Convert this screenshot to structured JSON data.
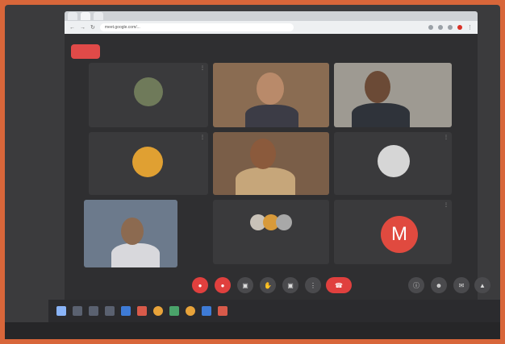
{
  "browser": {
    "tabs": [
      "",
      "",
      ""
    ],
    "url": "meet.google.com/..."
  },
  "meet": {
    "rec_label": "",
    "participants": [
      {
        "name": "",
        "kind": "avatar"
      },
      {
        "name": "",
        "kind": "video"
      },
      {
        "name": "",
        "kind": "video"
      },
      {
        "name": "",
        "kind": "avatar"
      },
      {
        "name": "",
        "kind": "video"
      },
      {
        "name": "",
        "kind": "avatar"
      },
      {
        "name": "",
        "kind": "video"
      },
      {
        "name": "",
        "kind": "group"
      },
      {
        "name": "",
        "kind": "letter",
        "letter": "M"
      }
    ],
    "time": "",
    "accent": "#e0403e"
  },
  "taskbar": {
    "clock": ""
  }
}
